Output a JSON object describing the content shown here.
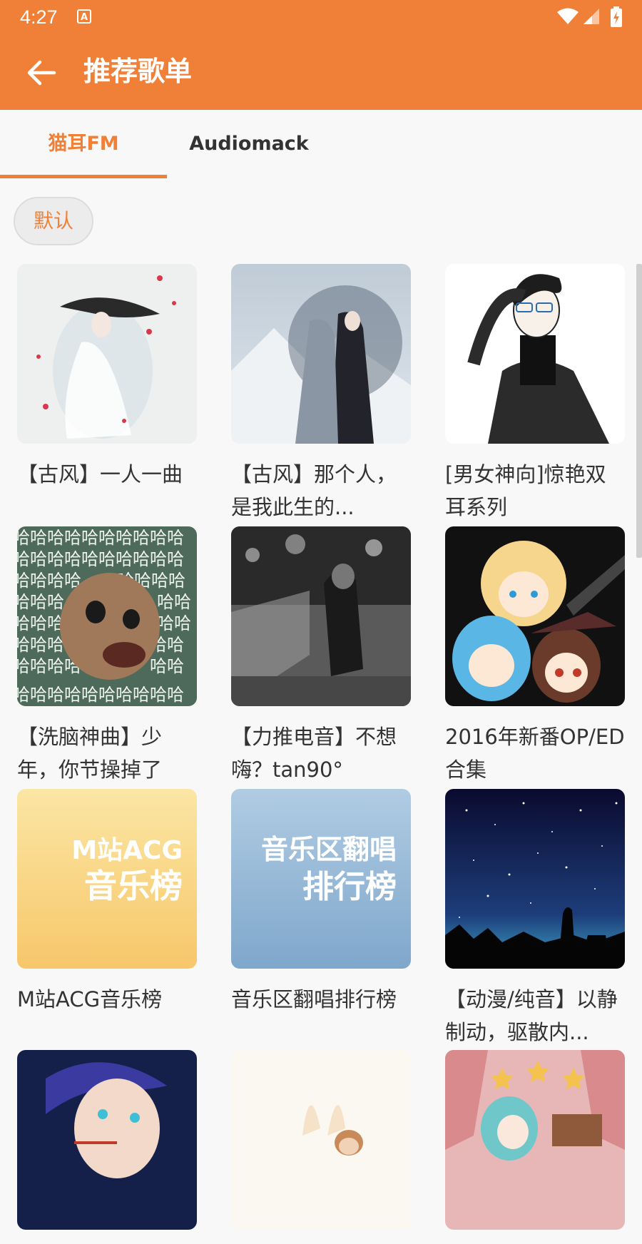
{
  "status_bar": {
    "time": "4:27",
    "notification_icon": "a-icon",
    "icons": [
      "wifi-icon",
      "signal-icon",
      "battery-icon"
    ]
  },
  "header": {
    "title": "推荐歌单",
    "back_icon": "arrow-left-icon"
  },
  "tabs": [
    {
      "label": "猫耳FM",
      "selected": true
    },
    {
      "label": "Audiomack",
      "selected": false
    }
  ],
  "filter_chip": {
    "label": "默认"
  },
  "playlists": [
    {
      "title": "【古风】一人一曲"
    },
    {
      "title": "【古风】那个人，是我此生的..."
    },
    {
      "title": "[男女神向]惊艳双耳系列"
    },
    {
      "title": "【洗脑神曲】少年，你节操掉了"
    },
    {
      "title": "【力推电音】不想嗨？tan90°"
    },
    {
      "title": "2016年新番OP/ED合集"
    },
    {
      "title": "M站ACG音乐榜",
      "cover_text": [
        "M站ACG",
        "音乐榜"
      ]
    },
    {
      "title": "音乐区翻唱排行榜",
      "cover_text": [
        "音乐区翻唱",
        "排行榜"
      ]
    },
    {
      "title": "【动漫/纯音】以静制动，驱散内..."
    },
    {
      "title": ""
    },
    {
      "title": ""
    },
    {
      "title": ""
    }
  ],
  "colors": {
    "accent": "#f08037",
    "background": "#f8f8f8",
    "text": "#333333"
  }
}
